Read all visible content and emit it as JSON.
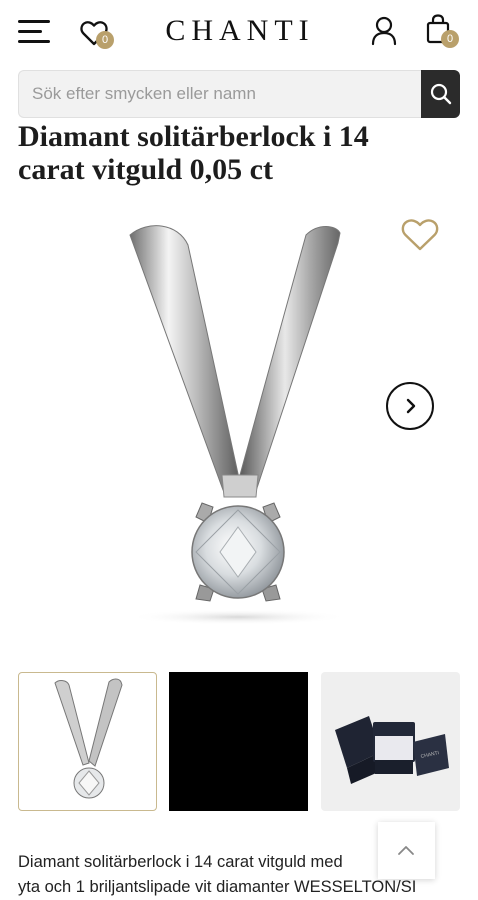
{
  "header": {
    "logo": "CHANTI",
    "wishlist_count": "0",
    "cart_count": "0",
    "icons": [
      "menu-icon",
      "heart-icon",
      "user-icon",
      "shopping-bag-icon"
    ]
  },
  "search": {
    "placeholder": "Sök efter smycken eller namn",
    "value": ""
  },
  "product": {
    "title_line1": "Diamant solitärberlock i 14",
    "title_line2": "carat vitguld 0,05 ct",
    "description_line1": "Diamant solitärberlock i 14 carat vitguld med",
    "description_line2": "yta och 1 briljantslipade vit diamanter WESSELTON/SI",
    "thumbnails": [
      "pendant-thumbnail",
      "video-thumbnail",
      "gift-box-thumbnail"
    ],
    "box_brand": "CHANTI"
  },
  "colors": {
    "accent_gold": "#b9a06b",
    "dark": "#2b2b2b"
  }
}
